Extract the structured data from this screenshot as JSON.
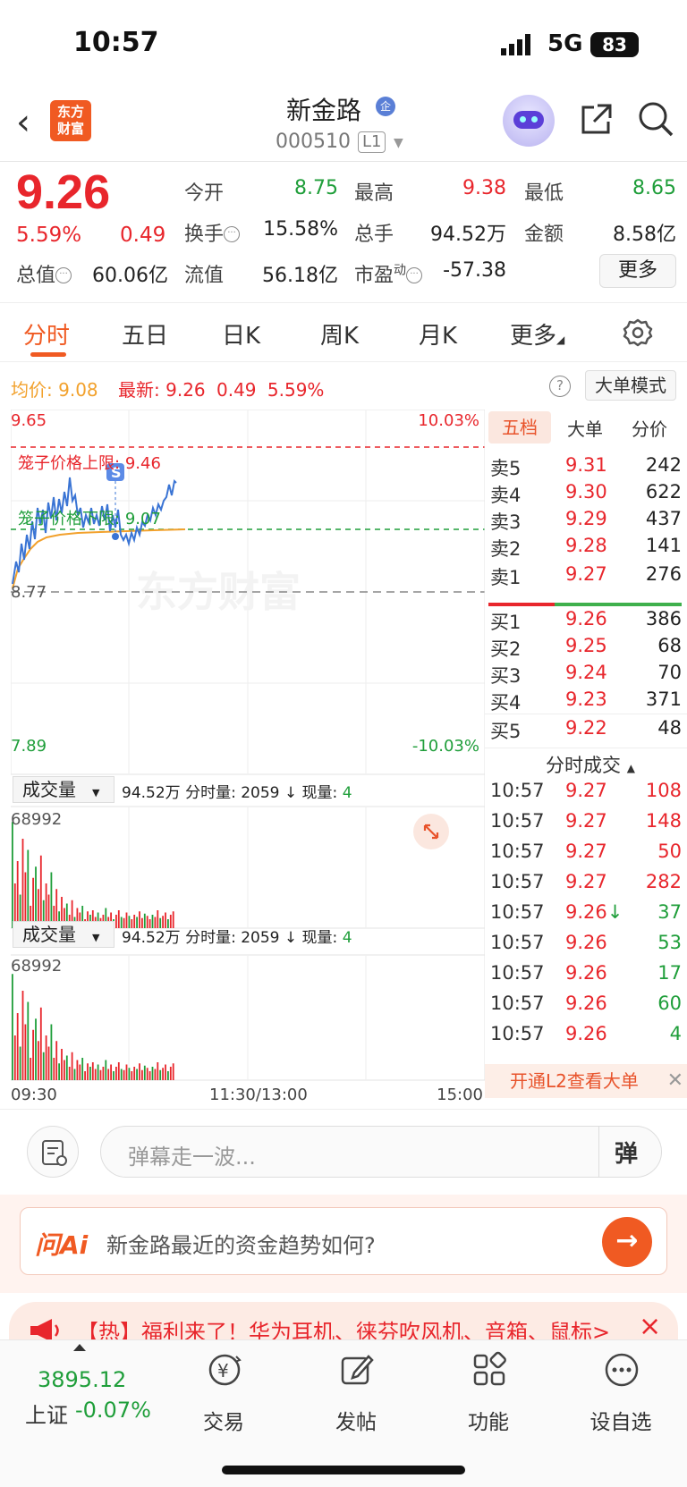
{
  "status_bar": {
    "time": "10:57",
    "network": "5G",
    "battery": "83"
  },
  "header": {
    "logo_text_1": "东方",
    "logo_text_2": "财富",
    "stock_name": "新金路",
    "badge": "企",
    "stock_code": "000510",
    "level": "L1"
  },
  "quote": {
    "price": "9.26",
    "change_pct": "5.59%",
    "change": "0.49",
    "open_label": "今开",
    "open": "8.75",
    "high_label": "最高",
    "high": "9.38",
    "low_label": "最低",
    "low": "8.65",
    "turnover_label": "换手",
    "turnover": "15.58%",
    "volume_label": "总手",
    "volume": "94.52万",
    "amount_label": "金额",
    "amount": "8.58亿",
    "mktcap_label": "总值",
    "mktcap": "60.06亿",
    "float_label": "流值",
    "float": "56.18亿",
    "pe_label": "市盈",
    "pe_sup": "动",
    "pe": "-57.38",
    "more": "更多"
  },
  "tabs": [
    "分时",
    "五日",
    "日K",
    "周K",
    "月K",
    "更多"
  ],
  "avg_row": {
    "avg_label": "均价:",
    "avg": "9.08",
    "last_label": "最新:",
    "last": "9.26",
    "chg": "0.49",
    "pct": "5.59%",
    "big_mode": "大单模式"
  },
  "chart": {
    "top_price": "9.65",
    "top_pct": "10.03%",
    "bottom_price": "7.89",
    "bottom_pct": "-10.03%",
    "prev_close": "8.77",
    "upper_limit_label": "笼子价格上限:",
    "upper_limit": "9.46",
    "lower_limit_label": "笼子价格下限:",
    "lower_limit": "9.07",
    "watermark": "东方财富",
    "vol1": {
      "label": "成交量",
      "total": "94.52万",
      "period_label": "分时量:",
      "period": "2059",
      "now_label": "现量:",
      "now": "4",
      "max": "68992"
    },
    "vol2": {
      "label": "成交量",
      "total": "94.52万",
      "period_label": "分时量:",
      "period": "2059",
      "now_label": "现量:",
      "now": "4",
      "max": "68992"
    },
    "time_start": "09:30",
    "time_mid": "11:30/13:00",
    "time_end": "15:00"
  },
  "book": {
    "tabs": [
      "五档",
      "大单",
      "分价"
    ],
    "asks": [
      {
        "label": "卖5",
        "price": "9.31",
        "vol": "242"
      },
      {
        "label": "卖4",
        "price": "9.30",
        "vol": "622"
      },
      {
        "label": "卖3",
        "price": "9.29",
        "vol": "437"
      },
      {
        "label": "卖2",
        "price": "9.28",
        "vol": "141"
      },
      {
        "label": "卖1",
        "price": "9.27",
        "vol": "276"
      }
    ],
    "bids": [
      {
        "label": "买1",
        "price": "9.26",
        "vol": "386"
      },
      {
        "label": "买2",
        "price": "9.25",
        "vol": "68"
      },
      {
        "label": "买3",
        "price": "9.24",
        "vol": "70"
      },
      {
        "label": "买4",
        "price": "9.23",
        "vol": "371"
      },
      {
        "label": "买5",
        "price": "9.22",
        "vol": "48"
      }
    ],
    "trades_title": "分时成交",
    "trades": [
      {
        "time": "10:57",
        "price": "9.27",
        "vol": "108",
        "dir": "up"
      },
      {
        "time": "10:57",
        "price": "9.27",
        "vol": "148",
        "dir": "up"
      },
      {
        "time": "10:57",
        "price": "9.27",
        "vol": "50",
        "dir": "up"
      },
      {
        "time": "10:57",
        "price": "9.27",
        "vol": "282",
        "dir": "up"
      },
      {
        "time": "10:57",
        "price": "9.26",
        "vol": "37",
        "dir": "down",
        "arrow": "↓"
      },
      {
        "time": "10:57",
        "price": "9.26",
        "vol": "53",
        "dir": "down"
      },
      {
        "time": "10:57",
        "price": "9.26",
        "vol": "17",
        "dir": "down"
      },
      {
        "time": "10:57",
        "price": "9.26",
        "vol": "60",
        "dir": "down"
      },
      {
        "time": "10:57",
        "price": "9.26",
        "vol": "4",
        "dir": "down"
      }
    ],
    "l2_banner": "开通L2查看大单"
  },
  "comment": {
    "placeholder": "弹幕走一波...",
    "danmu": "弹"
  },
  "ai": {
    "logo": "问Ai",
    "question": "新金路最近的资金趋势如何?"
  },
  "hot": {
    "text": "【热】福利来了！华为耳机、徕芬吹风机、音箱、鼠标>"
  },
  "nav": {
    "index_value": "3895.12",
    "index_name": "上证",
    "index_pct": "-0.07%",
    "items": [
      "交易",
      "发帖",
      "功能",
      "设自选"
    ]
  },
  "colors": {
    "up": "#e8262c",
    "down": "#1f9e3a",
    "accent": "#f05a22",
    "price_line": "#3a74d4",
    "avg_line": "#f2a12c"
  }
}
